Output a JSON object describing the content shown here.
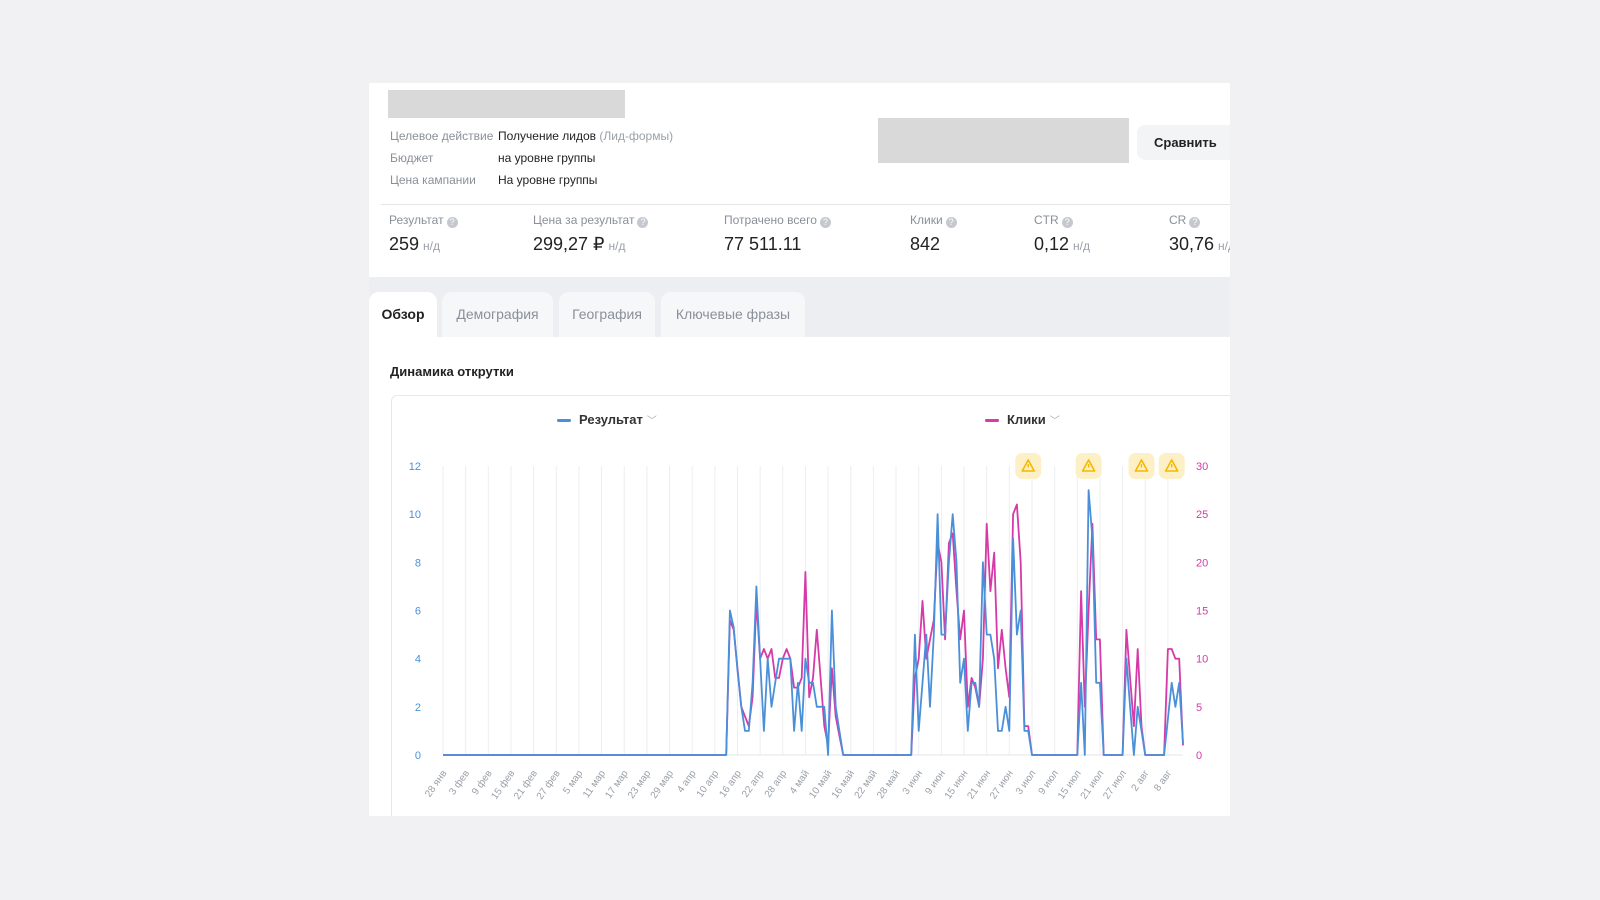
{
  "campaign": {
    "info": [
      {
        "label": "Целевое действие",
        "value": "Получение лидов",
        "note": "(Лид-формы)"
      },
      {
        "label": "Бюджет",
        "value": "на уровне группы",
        "note": ""
      },
      {
        "label": "Цена кампании",
        "value": "На уровне группы",
        "note": ""
      }
    ],
    "compare_label": "Сравнить"
  },
  "metrics": [
    {
      "label": "Результат",
      "value": "259",
      "suffix": "н/д"
    },
    {
      "label": "Цена за результат",
      "value": "299,27 ₽",
      "suffix": "н/д"
    },
    {
      "label": "Потрачено всего",
      "value": "77 511.11",
      "suffix": ""
    },
    {
      "label": "Клики",
      "value": "842",
      "suffix": ""
    },
    {
      "label": "CTR",
      "value": "0,12",
      "suffix": "н/д"
    },
    {
      "label": "CR",
      "value": "30,76",
      "suffix": "н/д"
    }
  ],
  "tabs": [
    {
      "label": "Обзор",
      "active": true
    },
    {
      "label": "Демография",
      "active": false
    },
    {
      "label": "География",
      "active": false
    },
    {
      "label": "Ключевые фразы",
      "active": false
    }
  ],
  "section_title": "Динамика открутки",
  "chart_data": {
    "type": "line",
    "legend": [
      "Результат",
      "Клики"
    ],
    "series": [
      {
        "name": "Результат",
        "axis": "left",
        "color": "#4a90d9"
      },
      {
        "name": "Клики",
        "axis": "right",
        "color": "#d63aa8"
      }
    ],
    "y_left": {
      "ylim": [
        0,
        12
      ],
      "ticks": [
        0,
        2,
        4,
        6,
        8,
        10,
        12
      ]
    },
    "y_right": {
      "ylim": [
        0,
        30
      ],
      "ticks": [
        0,
        5,
        10,
        15,
        20,
        25,
        30
      ]
    },
    "x_tick_labels": [
      "28 янв",
      "3 фев",
      "9 фев",
      "15 фев",
      "21 фев",
      "27 фев",
      "5 мар",
      "11 мар",
      "17 мар",
      "23 мар",
      "29 мар",
      "4 апр",
      "10 апр",
      "16 апр",
      "22 апр",
      "28 апр",
      "4 май",
      "10 май",
      "16 май",
      "22 май",
      "28 май",
      "3 июн",
      "9 июн",
      "15 июн",
      "21 июн",
      "27 июн",
      "3 июл",
      "9 июл",
      "15 июл",
      "21 июл",
      "27 июл",
      "2 авг",
      "8 авг"
    ],
    "x_range": [
      "01-28",
      "08-12"
    ],
    "grid": "vertical",
    "points_columns": [
      "date",
      "Результат",
      "Клики"
    ],
    "points": [
      [
        "01-28",
        0,
        0
      ],
      [
        "04-13",
        0,
        0
      ],
      [
        "04-14",
        6,
        14
      ],
      [
        "04-15",
        5.3,
        13
      ],
      [
        "04-16",
        3.5,
        9
      ],
      [
        "04-17",
        2,
        5
      ],
      [
        "04-18",
        1,
        4
      ],
      [
        "04-19",
        1,
        3
      ],
      [
        "04-20",
        3,
        6
      ],
      [
        "04-21",
        7,
        16
      ],
      [
        "04-22",
        4,
        10
      ],
      [
        "04-23",
        1,
        11
      ],
      [
        "04-24",
        4,
        10
      ],
      [
        "04-25",
        2,
        11
      ],
      [
        "04-26",
        3,
        8
      ],
      [
        "04-27",
        4,
        8
      ],
      [
        "04-28",
        4,
        10
      ],
      [
        "04-29",
        4,
        11
      ],
      [
        "04-30",
        4,
        10
      ],
      [
        "05-01",
        1,
        7
      ],
      [
        "05-02",
        3,
        7
      ],
      [
        "05-03",
        1,
        8
      ],
      [
        "05-04",
        4,
        19
      ],
      [
        "05-05",
        3,
        6
      ],
      [
        "05-06",
        3,
        8
      ],
      [
        "05-07",
        2,
        13
      ],
      [
        "05-08",
        2,
        8
      ],
      [
        "05-09",
        2,
        3
      ],
      [
        "05-10",
        0,
        1
      ],
      [
        "05-11",
        6,
        9
      ],
      [
        "05-12",
        2,
        4
      ],
      [
        "05-13",
        1,
        2
      ],
      [
        "05-14",
        0,
        0
      ],
      [
        "06-01",
        0,
        0
      ],
      [
        "06-02",
        5,
        8
      ],
      [
        "06-03",
        1,
        10
      ],
      [
        "06-04",
        3,
        16
      ],
      [
        "06-05",
        5,
        10
      ],
      [
        "06-06",
        2,
        12
      ],
      [
        "06-07",
        5,
        14
      ],
      [
        "06-08",
        10,
        22
      ],
      [
        "06-09",
        5,
        20
      ],
      [
        "06-10",
        5,
        12
      ],
      [
        "06-11",
        8,
        22
      ],
      [
        "06-12",
        10,
        23
      ],
      [
        "06-13",
        8,
        17
      ],
      [
        "06-14",
        3,
        12
      ],
      [
        "06-15",
        4,
        15
      ],
      [
        "06-16",
        1,
        5
      ],
      [
        "06-17",
        3,
        8
      ],
      [
        "06-18",
        3,
        7
      ],
      [
        "06-19",
        2,
        5
      ],
      [
        "06-20",
        8,
        10
      ],
      [
        "06-21",
        5,
        24
      ],
      [
        "06-22",
        5,
        17
      ],
      [
        "06-23",
        4,
        21
      ],
      [
        "06-24",
        1,
        9
      ],
      [
        "06-25",
        1,
        13
      ],
      [
        "06-26",
        2,
        9
      ],
      [
        "06-27",
        1,
        6
      ],
      [
        "06-28",
        9,
        25
      ],
      [
        "06-29",
        5,
        26
      ],
      [
        "06-30",
        6,
        20
      ],
      [
        "07-01",
        1,
        3
      ],
      [
        "07-02",
        1,
        3
      ],
      [
        "07-03",
        0,
        0
      ],
      [
        "07-15",
        0,
        0
      ],
      [
        "07-16",
        3,
        17
      ],
      [
        "07-17",
        0,
        5
      ],
      [
        "07-18",
        11,
        15
      ],
      [
        "07-19",
        9,
        24
      ],
      [
        "07-20",
        3,
        12
      ],
      [
        "07-21",
        3,
        12
      ],
      [
        "07-22",
        0,
        0
      ],
      [
        "07-27",
        0,
        0
      ],
      [
        "07-28",
        4,
        13
      ],
      [
        "07-29",
        2,
        8
      ],
      [
        "07-30",
        0,
        3
      ],
      [
        "07-31",
        2,
        11
      ],
      [
        "08-01",
        1,
        3
      ],
      [
        "08-02",
        0,
        0
      ],
      [
        "08-07",
        0,
        0
      ],
      [
        "08-08",
        1.5,
        11
      ],
      [
        "08-09",
        3,
        11
      ],
      [
        "08-10",
        2,
        10
      ],
      [
        "08-11",
        3,
        10
      ],
      [
        "08-12",
        0.5,
        1
      ]
    ],
    "warning_markers": [
      "07-02",
      "07-18",
      "08-01",
      "08-09"
    ],
    "warning_color": "#f5b800"
  }
}
